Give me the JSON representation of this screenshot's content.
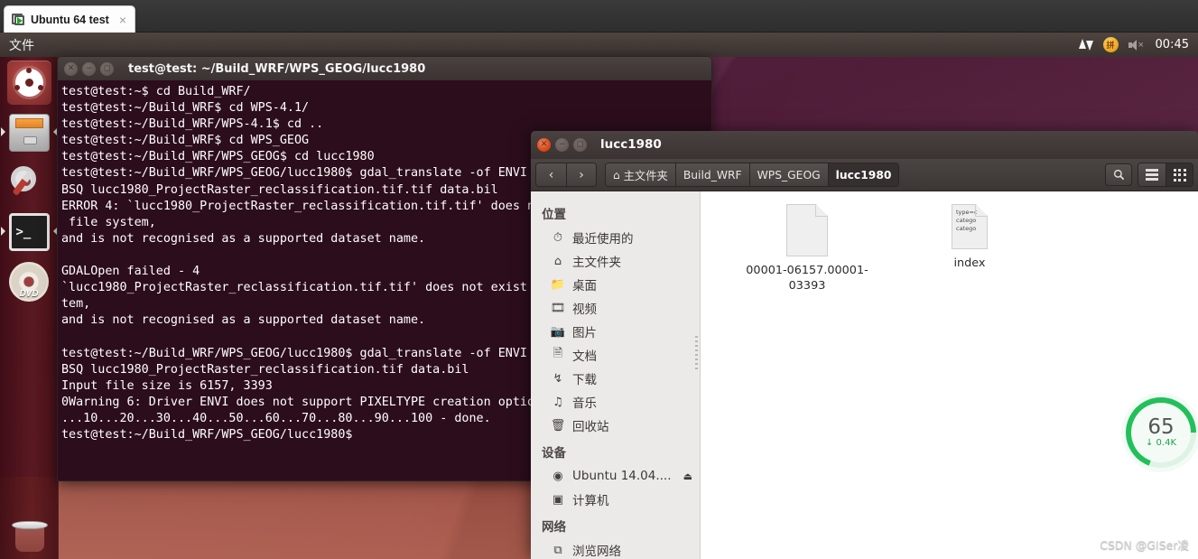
{
  "vmware": {
    "tab_label": "Ubuntu 64 test",
    "close_label": "×",
    "icon": "vm-screen-icon"
  },
  "panel": {
    "menu_label": "文件",
    "ime_glyph": "拼",
    "volume_x": "×",
    "clock": "00:45"
  },
  "launcher": {
    "items": [
      {
        "name": "ubuntu-dash",
        "label": "Dash"
      },
      {
        "name": "files",
        "label": "Files"
      },
      {
        "name": "system-settings",
        "label": "System Settings"
      },
      {
        "name": "terminal",
        "label": "Terminal",
        "glyph": ">_"
      },
      {
        "name": "dvd",
        "label": "DVD",
        "glyph": "DVD"
      },
      {
        "name": "trash",
        "label": "Trash"
      }
    ]
  },
  "terminal": {
    "title": "test@test: ~/Build_WRF/WPS_GEOG/lucc1980",
    "lines": "test@test:~$ cd Build_WRF/\ntest@test:~/Build_WRF$ cd WPS-4.1/\ntest@test:~/Build_WRF/WPS-4.1$ cd ..\ntest@test:~/Build_WRF$ cd WPS_GEOG\ntest@test:~/Build_WRF/WPS_GEOG$ cd lucc1980\ntest@test:~/Build_WRF/WPS_GEOG/lucc1980$ gdal_translate -of ENVI -co INTERLEAVE=\nBSQ lucc1980_ProjectRaster_reclassification.tif.tif data.bil\nERROR 4: `lucc1980_ProjectRaster_reclassification.tif.tif' does not exist in the\n file system,\nand is not recognised as a supported dataset name.\n\nGDALOpen failed - 4\n`lucc1980_ProjectRaster_reclassification.tif.tif' does not exist in the file sys\ntem,\nand is not recognised as a supported dataset name.\n\ntest@test:~/Build_WRF/WPS_GEOG/lucc1980$ gdal_translate -of ENVI -co INTERLEAVE=\nBSQ lucc1980_ProjectRaster_reclassification.tif data.bil\nInput file size is 6157, 3393\n0Warning 6: Driver ENVI does not support PIXELTYPE creation option\n...10...20...30...40...50...60...70...80...90...100 - done.\ntest@test:~/Build_WRF/WPS_GEOG/lucc1980$ "
  },
  "filemanager": {
    "title": "lucc1980",
    "nav": {
      "back": "‹",
      "forward": "›"
    },
    "breadcrumbs": [
      {
        "label": "主文件夹",
        "home": true,
        "active": false
      },
      {
        "label": "Build_WRF",
        "home": false,
        "active": false
      },
      {
        "label": "WPS_GEOG",
        "home": false,
        "active": false
      },
      {
        "label": "lucc1980",
        "home": false,
        "active": true
      }
    ],
    "sidebar": [
      {
        "type": "header",
        "label": "位置"
      },
      {
        "type": "item",
        "label": "最近使用的",
        "icon": "◴",
        "name": "recent"
      },
      {
        "type": "item",
        "label": "主文件夹",
        "icon": "⌂",
        "name": "home"
      },
      {
        "type": "item",
        "label": "桌面",
        "icon": "🖿",
        "name": "desktop"
      },
      {
        "type": "item",
        "label": "视频",
        "icon": "☰",
        "name": "videos"
      },
      {
        "type": "item",
        "label": "图片",
        "icon": "❐",
        "name": "pictures"
      },
      {
        "type": "item",
        "label": "文档",
        "icon": "❐",
        "name": "documents"
      },
      {
        "type": "item",
        "label": "下载",
        "icon": "↓",
        "name": "downloads"
      },
      {
        "type": "item",
        "label": "音乐",
        "icon": "♫",
        "name": "music"
      },
      {
        "type": "item",
        "label": "回收站",
        "icon": "⌧",
        "name": "trash"
      },
      {
        "type": "header",
        "label": "设备"
      },
      {
        "type": "item",
        "label": "Ubuntu 14.04....",
        "icon": "◉",
        "name": "ubuntu-disc",
        "eject": "⏏"
      },
      {
        "type": "item",
        "label": "计算机",
        "icon": "▣",
        "name": "computer"
      },
      {
        "type": "header",
        "label": "网络"
      },
      {
        "type": "item",
        "label": "浏览网络",
        "icon": "⧉",
        "name": "browse-network"
      }
    ],
    "files": [
      {
        "name": "00001-06157.00001-03393",
        "preview": "",
        "kind": "file"
      },
      {
        "name": "index",
        "preview": "type=c\ncatego\ncatego",
        "kind": "text-file"
      }
    ],
    "toolbar": {
      "search": "⚲",
      "menu": "hamburger-icon",
      "grid": "grid-icon"
    }
  },
  "netwidget": {
    "value": "65",
    "rate": "↓ 0.4K"
  },
  "watermark": "CSDN @GISer凌",
  "colors": {
    "accent_orange": "#dd4814",
    "desktop_purple": "#5d2344",
    "terminal_bg": "#2c0d1c",
    "green": "#22c05a"
  }
}
